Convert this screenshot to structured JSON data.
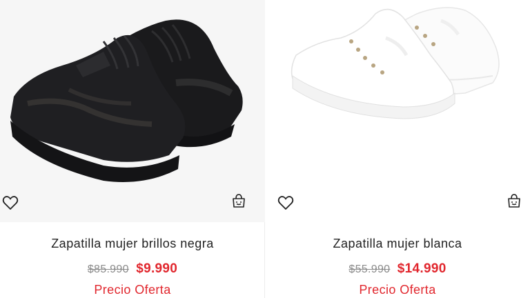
{
  "products": [
    {
      "title": "Zapatilla mujer brillos negra",
      "old_price": "$85.990",
      "price": "$9.990",
      "offer_label": "Precio Oferta",
      "colors": {
        "shoe": "#1c1c1e",
        "sole": "#151517"
      },
      "icons": {
        "wishlist": "heart-icon",
        "cart": "shopping-bag-icon"
      }
    },
    {
      "title": "Zapatilla mujer blanca",
      "old_price": "$55.990",
      "price": "$14.990",
      "offer_label": "Precio Oferta",
      "colors": {
        "shoe": "#ffffff",
        "sole": "#f4f4f4"
      },
      "icons": {
        "wishlist": "heart-icon",
        "cart": "shopping-bag-icon"
      }
    }
  ],
  "theme": {
    "sale_color": "#e1262d",
    "strike_color": "#8a8a8a",
    "text_color": "#222222"
  }
}
